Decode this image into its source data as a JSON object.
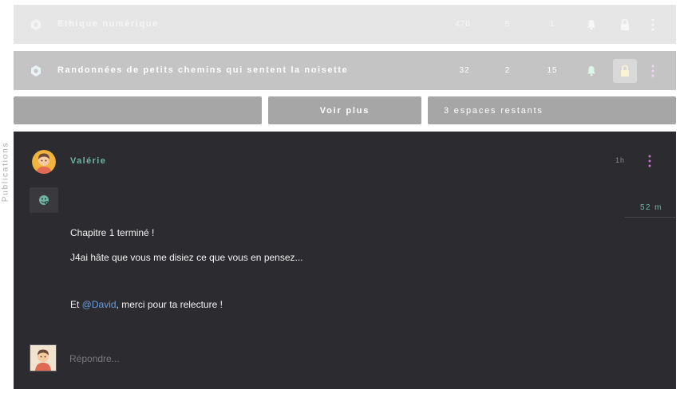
{
  "spaces": [
    {
      "name": "Ethique numérique",
      "stat1": "470",
      "stat2": "5",
      "stat3": "1"
    },
    {
      "name": "Randonnées de petits chemins qui sentent la noisette",
      "stat1": "32",
      "stat2": "2",
      "stat3": "15"
    }
  ],
  "buttons": {
    "more_label": "Voir plus",
    "remaining_label": "3 espaces restants"
  },
  "side_label": "Publications",
  "post": {
    "author": "Valérie",
    "time": "1h",
    "read_time": "52 m",
    "line1": "Chapitre 1 terminé !",
    "line2": "J4ai hâte que vous me disiez ce que vous en pensez...",
    "line3_prefix": "Et ",
    "line3_mention": "@David",
    "line3_suffix": ", merci pour ta relecture !"
  },
  "reply": {
    "placeholder": "Répondre..."
  },
  "colors": {
    "accent_teal": "#6fb5a3",
    "accent_pink": "#c86fd0",
    "mention_blue": "#6c9bd2",
    "post_bg": "#2c2c30"
  }
}
